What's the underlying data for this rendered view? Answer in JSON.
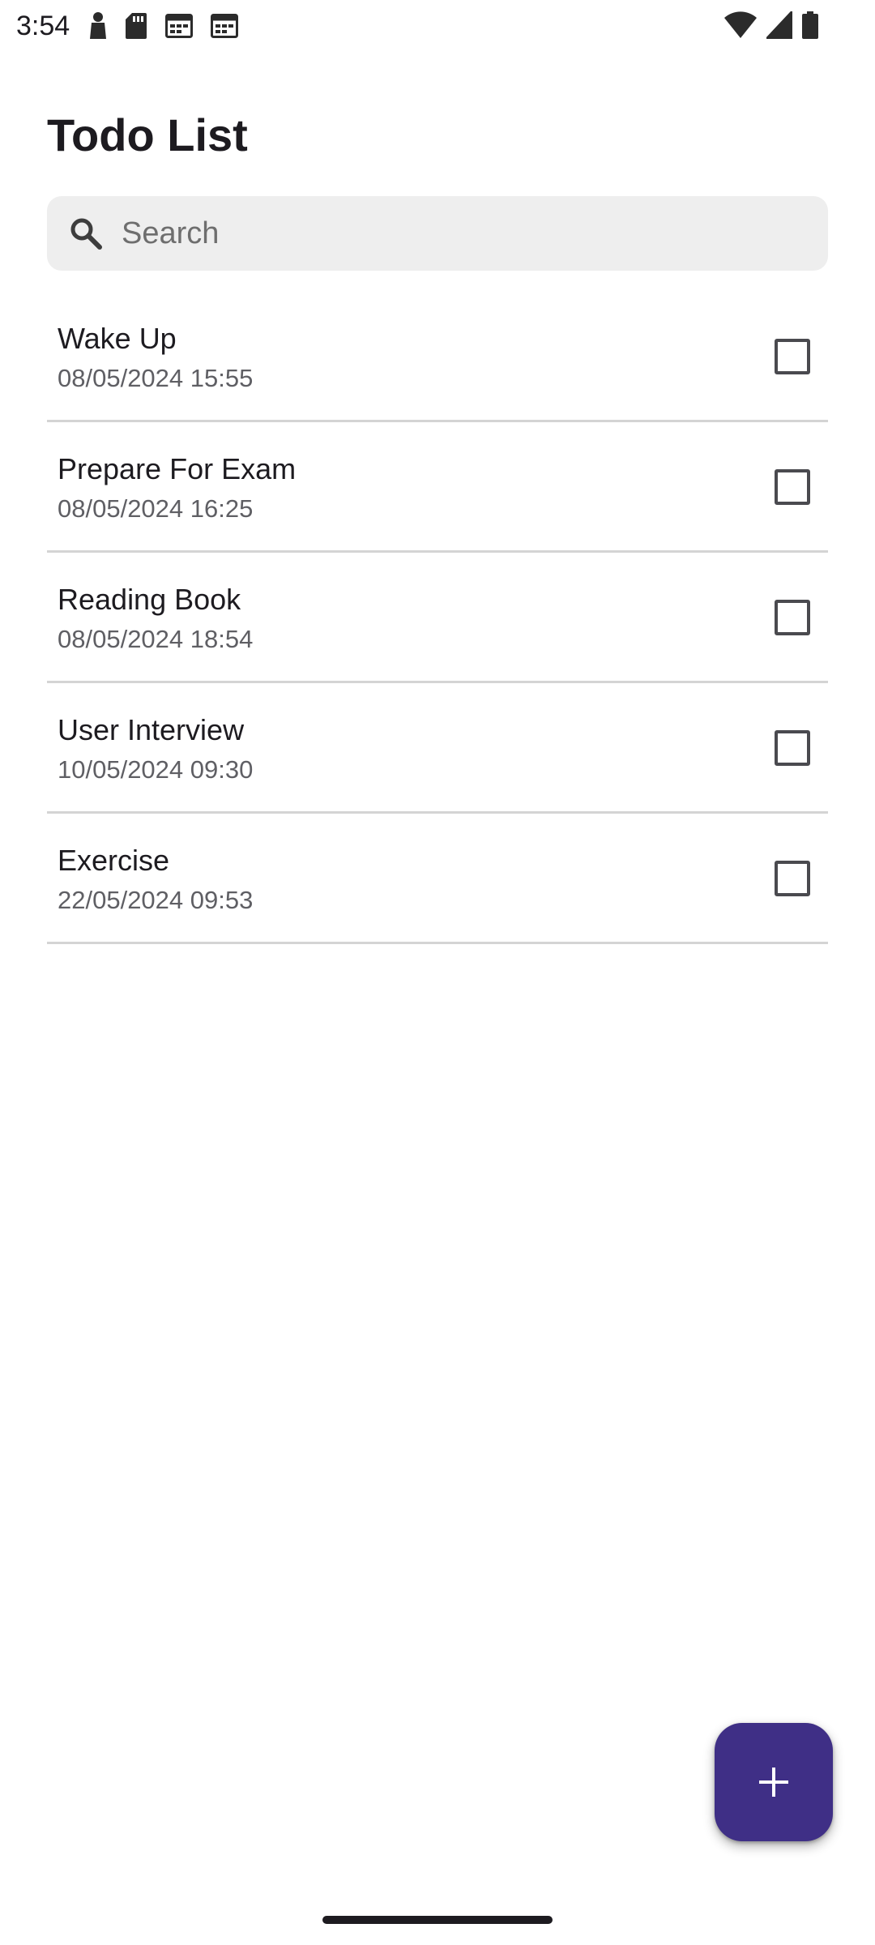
{
  "status_bar": {
    "time": "3:54",
    "left_icons": [
      "person-icon",
      "sd-card-icon",
      "calendar-icon",
      "calendar-icon"
    ],
    "right_icons": [
      "wifi-icon",
      "cell-signal-icon",
      "battery-icon"
    ]
  },
  "header": {
    "title": "Todo List"
  },
  "search": {
    "placeholder": "Search",
    "value": ""
  },
  "todos": [
    {
      "title": "Wake Up",
      "date": "08/05/2024 15:55",
      "checked": false
    },
    {
      "title": "Prepare For Exam",
      "date": "08/05/2024 16:25",
      "checked": false
    },
    {
      "title": "Reading Book",
      "date": "08/05/2024 18:54",
      "checked": false
    },
    {
      "title": "User Interview",
      "date": "10/05/2024 09:30",
      "checked": false
    },
    {
      "title": "Exercise",
      "date": "22/05/2024 09:53",
      "checked": false
    }
  ],
  "fab": {
    "icon": "plus-icon"
  },
  "colors": {
    "fab_background": "#3f2f86",
    "search_background": "#eeeeee",
    "divider": "#d4d4d4"
  }
}
